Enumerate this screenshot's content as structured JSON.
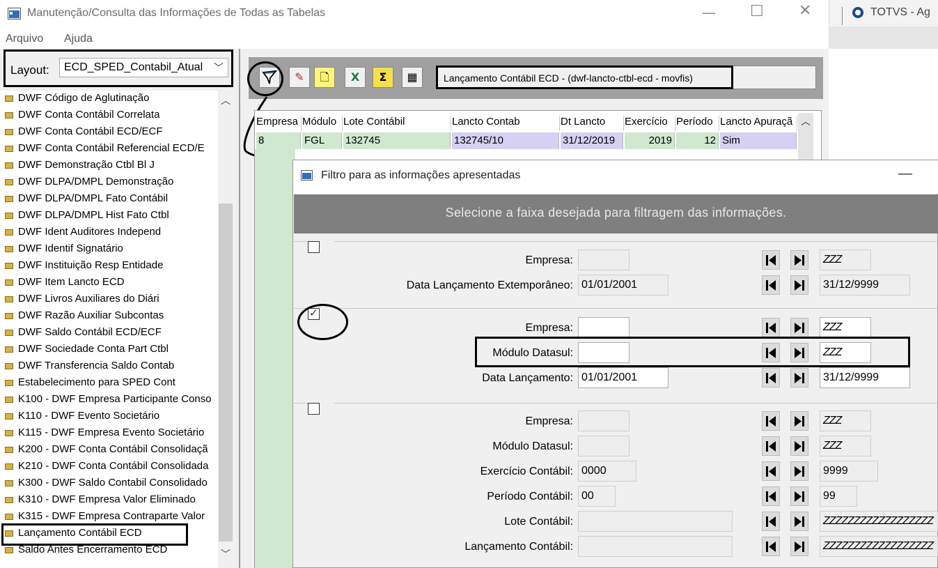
{
  "window": {
    "title": "Manutenção/Consulta das Informações de Todas as Tabelas"
  },
  "other_app": {
    "title": "TOTVS - Ag"
  },
  "menu": [
    "Arquivo",
    "Ajuda"
  ],
  "layout": {
    "label": "Layout:",
    "value": "ECD_SPED_Contabil_Atual"
  },
  "tree_items": [
    "DWF Código de Aglutinação",
    "DWF Conta Contábil Correlata",
    "DWF Conta Contábil ECD/ECF",
    "DWF Conta Contábil Referencial ECD/E",
    "DWF Demonstração Ctbl Bl J",
    "DWF DLPA/DMPL Demonstração",
    "DWF DLPA/DMPL Fato Contábil",
    "DWF DLPA/DMPL Hist Fato Ctbl",
    "DWF Ident Auditores Independ",
    "DWF Identif Signatário",
    "DWF Instituição Resp Entidade",
    "DWF Item Lancto ECD",
    "DWF Livros Auxiliares do Diári",
    "DWF Razão Auxiliar Subcontas",
    "DWF Saldo Contábil ECD/ECF",
    "DWF Sociedade Conta Part Ctbl",
    "DWF Transferencia Saldo Contab",
    "Estabelecimento para SPED Cont",
    "K100 - DWF Empresa Participante Conso",
    "K110 - DWF Evento Societário",
    "K115 - DWF Empresa Evento Societário",
    "K200 - DWF Conta Contábil Consolidaçã",
    "K210 - DWF Conta Contábil Consolidada",
    "K300 - DWF Saldo Contabil Consolidado",
    "K310 - DWF Empresa Valor Eliminado",
    "K315 - DWF Empresa Contraparte Valor",
    "Lançamento Contábil ECD",
    "Saldo Antes Encerramento ECD"
  ],
  "toolbar": {
    "buttons": [
      "filter-icon",
      "edit-icon",
      "new-document-icon",
      "excel-export-icon",
      "sum-icon",
      "properties-icon"
    ],
    "table_name": "Lançamento Contábil ECD - (dwf-lancto-ctbl-ecd - movfis)"
  },
  "grid": {
    "columns": [
      "Empresa",
      "Módulo",
      "Lote Contábil",
      "Lancto Contab",
      "Dt Lancto",
      "Exercício",
      "Período",
      "Lancto Apuraçã"
    ],
    "rows": [
      [
        "8",
        "FGL",
        "132745",
        "132745/10",
        "31/12/2019",
        "2019",
        "12",
        "Sim"
      ]
    ]
  },
  "dialog": {
    "title": "Filtro para as informações apresentadas",
    "banner": "Selecione a faixa desejada para filtragem das informações.",
    "groups": [
      {
        "checked": false,
        "fields": [
          {
            "label": "Empresa:",
            "from": "",
            "to": "ZZZ"
          },
          {
            "label": "Data Lançamento Extemporâneo:",
            "from": "01/01/2001",
            "to": "31/12/9999"
          }
        ]
      },
      {
        "checked": true,
        "fields": [
          {
            "label": "Empresa:",
            "from": "",
            "to": "ZZZ"
          },
          {
            "label": "Módulo Datasul:",
            "from": "",
            "to": "ZZZ"
          },
          {
            "label": "Data Lançamento:",
            "from": "01/01/2001",
            "to": "31/12/9999"
          }
        ]
      },
      {
        "checked": false,
        "fields": [
          {
            "label": "Empresa:",
            "from": "",
            "to": "ZZZ"
          },
          {
            "label": "Módulo Datasul:",
            "from": "",
            "to": "ZZZ"
          },
          {
            "label": "Exercício Contábil:",
            "from": "0000",
            "to": "9999"
          },
          {
            "label": "Período Contábil:",
            "from": "00",
            "to": "99"
          },
          {
            "label": "Lote Contábil:",
            "from": "",
            "to": "ZZZZZZZZZZZZZZZZZZ"
          },
          {
            "label": "Lançamento Contábil:",
            "from": "",
            "to": "ZZZZZZZZZZZZZZZZZZ"
          }
        ]
      }
    ]
  }
}
